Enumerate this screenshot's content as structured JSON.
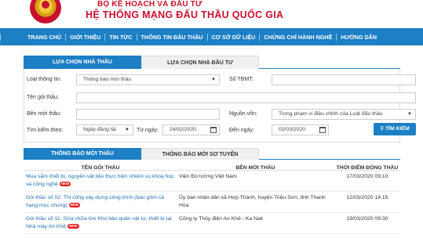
{
  "header": {
    "ministry": "BỘ KẾ HOẠCH VÀ ĐẦU TƯ",
    "title": "HỆ THỐNG MẠNG ĐẤU THẦU QUỐC GIA"
  },
  "nav": [
    "TRANG CHỦ",
    "GIỚI THIỆU",
    "TIN TỨC",
    "THÔNG TIN ĐẤU THẦU",
    "CƠ SỞ DỮ LIỆU",
    "CHỨNG CHỈ HÀNH NGHỀ",
    "HƯỚNG DẪN"
  ],
  "tabs_top": {
    "active": "LỰA CHỌN NHÀ THẦU",
    "inactive": "LỰA CHỌN NHÀ ĐẦU TƯ"
  },
  "form": {
    "info_type_label": "Loại thông tin:",
    "info_type_value": "Thông báo mời thầu",
    "tbmt_label": "Số TBMT:",
    "package_name_label": "Tên gói thầu:",
    "inviter_label": "Bên mời thầu:",
    "source_label": "Nguồn vốn:",
    "source_value": "Trong phạm vi điều chỉnh của Luật đấu thầu",
    "search_by_label": "Tìm kiếm theo:",
    "search_by_value": "Ngày đăng tải",
    "from_label": "Từ ngày:",
    "from_value": "24/02/2020",
    "to_label": "Đến ngày:",
    "to_value": "02/03/2020",
    "search_button": "TÌM KIẾM"
  },
  "tabs_bottom": {
    "active": "THÔNG BÁO MỜI THẦU",
    "inactive": "THÔNG BÁO MỜI SƠ TUYỂN"
  },
  "table": {
    "headers": [
      "TÊN GÓI THẦU",
      "BÊN MỜI THẦU",
      "THỜI ĐIỂM ĐÓNG THẦU"
    ],
    "new_badge": "NEW",
    "rows": [
      {
        "name": "Mua sắm thiết bị, nguyên vật liệu thực hiện nhiệm vụ khoa học và công nghệ",
        "inviter": "Viện Đo lường Việt Nam",
        "close": "17/03/2020 09:10"
      },
      {
        "name": "Gói thầu số 02: Thi công xây dựng công trình (bao gồm cả hạng mục chung)",
        "inviter": "Ủy ban nhân dân xã Hợp Thành, huyện Triệu Sơn, tỉnh Thanh Hóa",
        "close": "12/03/2020 14:15"
      },
      {
        "name": "Gói thầu số 11: Sửa chữa lớn Kho bảo quản vật tư, thiết bị tại Nhà máy An Khê",
        "inviter": "Công ty Thủy điện An Khê - Ka Nak",
        "close": "19/03/2020 09:30"
      }
    ]
  },
  "colors": {
    "accent": "#1d7fc4",
    "brand_red": "#c8102e",
    "link": "#1d6fb8",
    "badge": "#e31b1b"
  }
}
